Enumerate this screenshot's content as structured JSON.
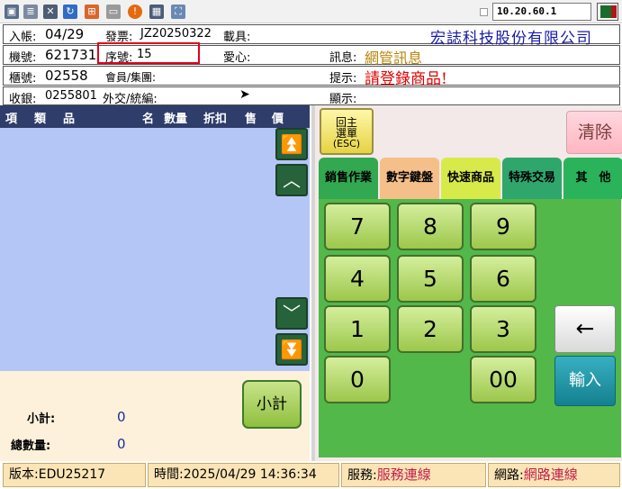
{
  "toolbar": {
    "ip": "10.20.60.1",
    "colors": {
      "flag_green": "#1a6b2c",
      "flag_red": "#b01818"
    },
    "icons": [
      "window-icon",
      "doc-icon",
      "tools-icon",
      "refresh-icon",
      "windows-logo-icon",
      "drive-icon",
      "alert-icon",
      "network-icon",
      "fullscreen-icon"
    ]
  },
  "info": {
    "row1": {
      "entry_label": "入帳:",
      "entry_value": "04/29",
      "invoice_label": "發票:",
      "invoice_value": "JZ20250322",
      "carrier_label": "載具:",
      "company": "宏誌科技股份有限公司"
    },
    "row2": {
      "machine_label": "機號:",
      "machine_value": "621731",
      "seq_label": "序號:",
      "seq_value": "15",
      "love_label": "愛心:",
      "msg_label": "訊息:",
      "msg_value": "網管訊息"
    },
    "row3": {
      "counter_label": "櫃號:",
      "counter_value": "02558",
      "member_label": "會員/集團:",
      "hint_label": "提示:",
      "hint_value": "請登錄商品!"
    },
    "row4": {
      "cashier_label": "收銀:",
      "cashier_value": "0255801",
      "diplomat_label": "外交/統編:",
      "display_label": "顯示:"
    }
  },
  "list": {
    "headers": [
      "項",
      "類",
      "品",
      "名",
      "數量",
      "折扣",
      "售",
      "價"
    ],
    "subtotal_label": "小計:",
    "subtotal_value": "0",
    "total_qty_label": "總數量:",
    "total_qty_value": "0",
    "subtotal_button": "小計"
  },
  "panel": {
    "esc_line1": "回主",
    "esc_line2": "選單",
    "esc_line3": "(ESC)",
    "clear": "清除",
    "tabs": [
      {
        "label": "銷售作業",
        "color": "#32a850"
      },
      {
        "label": "數字鍵盤",
        "color": "#f5bf8a"
      },
      {
        "label": "快速商品",
        "color": "#d8ea4a"
      },
      {
        "label": "特殊交易",
        "color": "#2fa66c"
      },
      {
        "label": "其　他",
        "color": "#2ab35a"
      }
    ],
    "keys": [
      "7",
      "8",
      "9",
      "4",
      "5",
      "6",
      "1",
      "2",
      "3",
      "0",
      "00"
    ],
    "back_label": "←",
    "enter_label": "輸入"
  },
  "status": {
    "version_label": "版本:",
    "version_value": "EDU25217",
    "time_label": "時間:",
    "time_value": "2025/04/29 14:36:34",
    "service_label": "服務:",
    "service_value": "服務連線",
    "network_label": "網路:",
    "network_value": "網路連線"
  }
}
